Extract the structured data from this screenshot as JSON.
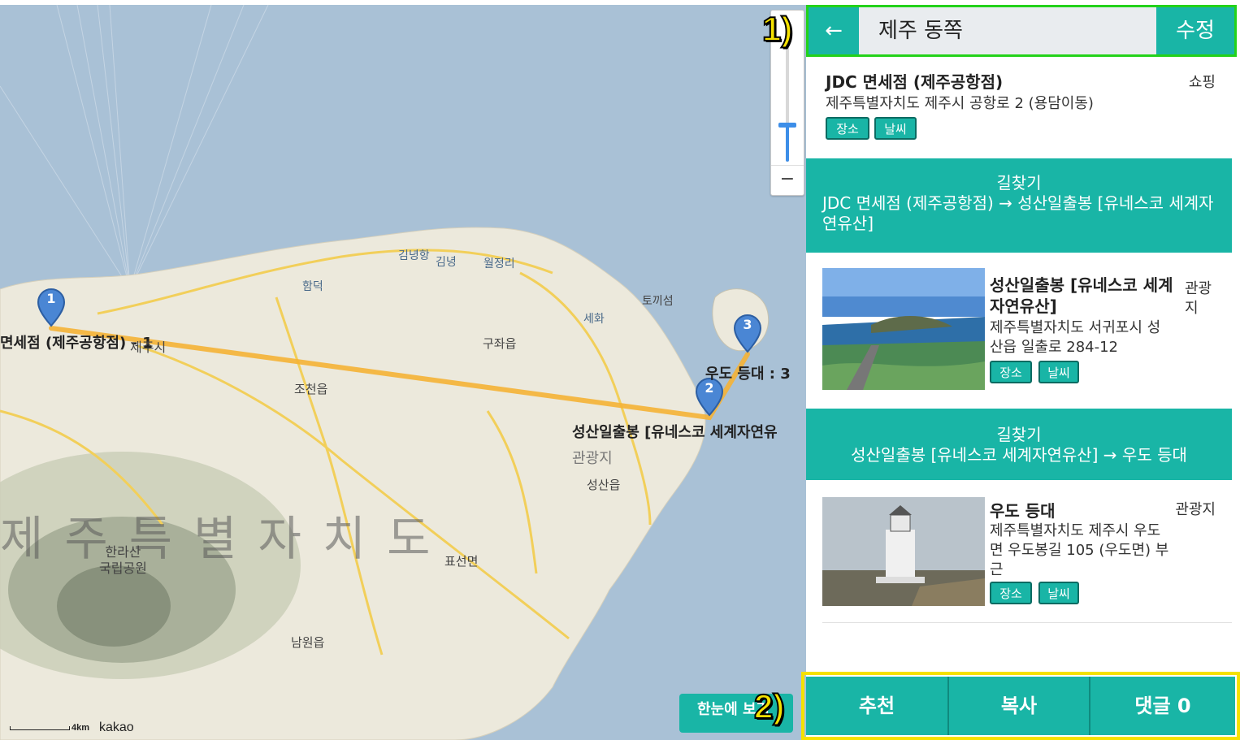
{
  "map": {
    "labels": {
      "airport_label": "면세점 (제주공항점) - 1",
      "jeju_si": "제주시",
      "gujwa": "구좌읍",
      "jocheon": "조천읍",
      "seongsan_eup": "성산읍",
      "pyoseon": "표선면",
      "namwon": "남원읍",
      "seongsan_label": "성산일출봉 [유네스코 세계자연유",
      "udo_label": "우도 등대 : 3",
      "gwangwangji": "관광지",
      "province": "제주특별자치도",
      "hallasan": "한라산\n국립공원",
      "gimnyeong_port": "김녕항",
      "gimnyeong": "김녕",
      "woljeongri": "월정리",
      "hamdeok": "함덕",
      "sehwa": "세화",
      "tokkiseom": "토끼섬"
    },
    "markers": [
      "1",
      "2",
      "3"
    ],
    "scale_text": "4km",
    "logo": "kakao",
    "overview_button": "한눈에 보기",
    "zoom_minus": "−"
  },
  "annotations": {
    "one": "1)",
    "two": "2)"
  },
  "panel": {
    "back": "←",
    "title": "제주 동쪽",
    "edit": "수정",
    "places": [
      {
        "name": "JDC 면세점 (제주공항점)",
        "address": "제주특별자치도 제주시 공항로 2 (용담이동)",
        "category": "쇼핑",
        "tags": [
          "장소",
          "날씨"
        ]
      },
      {
        "name": "성산일출봉 [유네스코 세계자연유산]",
        "address": "제주특별자치도 서귀포시 성산읍 일출로 284-12",
        "category": "관광지",
        "tags": [
          "장소",
          "날씨"
        ]
      },
      {
        "name": "우도 등대",
        "address": "제주특별자치도 제주시 우도면 우도봉길 105 (우도면) 부근",
        "category": "관광지",
        "tags": [
          "장소",
          "날씨"
        ]
      }
    ],
    "routes": [
      {
        "title": "길찾기",
        "text": "JDC 면세점 (제주공항점) → 성산일출봉 [유네스코 세계자연유산]"
      },
      {
        "title": "길찾기",
        "text": "성산일출봉 [유네스코 세계자연유산] → 우도 등대"
      }
    ],
    "footer": {
      "recommend": "추천",
      "copy": "복사",
      "comments": "댓글 0"
    }
  },
  "colors": {
    "accent": "#19b5a6",
    "annotation_green": "#23d21a",
    "annotation_yellow": "#f5e100",
    "route_line": "#f5b335"
  }
}
